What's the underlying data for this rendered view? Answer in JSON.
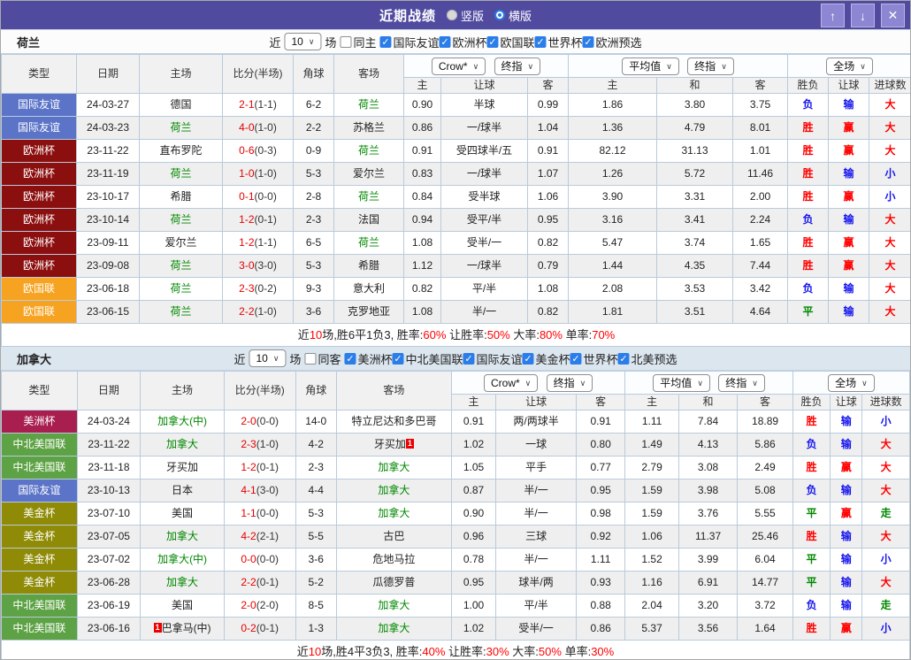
{
  "title_bar": {
    "title": "近期战绩",
    "radio_options": [
      {
        "label": "竖版",
        "selected": false
      },
      {
        "label": "横版",
        "selected": true
      }
    ],
    "buttons": {
      "up": "↑",
      "down": "↓",
      "close": "✕"
    }
  },
  "colors": {
    "titlebar_bg": "#514ba0",
    "focus_team": "#008800",
    "score_red": "#e60000",
    "red_card_badge": "#ee0000",
    "checkbox_blue": "#2b7de9",
    "league": {
      "国际友谊": "#5b74c8",
      "欧洲杯": "#8c0f0f",
      "欧国联": "#f6a321",
      "美洲杯": "#a81e4f",
      "中北美国联": "#5da244",
      "美金杯": "#8f8b06"
    },
    "result": {
      "胜": "#ff0000",
      "负": "#1616ee",
      "平": "#008800",
      "赢": "#ff0000",
      "输": "#1616ee",
      "走": "#008800",
      "大": "#ff0000",
      "小": "#1616ee"
    }
  },
  "table_header": {
    "type": "类型",
    "date": "日期",
    "home": "主场",
    "score": "比分(半场)",
    "corner": "角球",
    "away": "客场",
    "dropdowns": {
      "source": "Crow*",
      "final1": "终指",
      "average": "平均值",
      "final2": "终指",
      "scope": "全场"
    },
    "sub": {
      "home": "主",
      "handicap": "让球",
      "away": "客",
      "avg_home": "主",
      "avg_draw": "和",
      "avg_away": "客",
      "result": "胜负",
      "handicap_result": "让球",
      "goals": "进球数"
    }
  },
  "sections": [
    {
      "team": "荷兰",
      "filter": {
        "near": "近",
        "count": "10",
        "games": "场",
        "same": {
          "label": "同主",
          "checked": false
        },
        "leagues": [
          {
            "label": "国际友谊",
            "checked": true
          },
          {
            "label": "欧洲杯",
            "checked": true
          },
          {
            "label": "欧国联",
            "checked": true
          },
          {
            "label": "世界杯",
            "checked": true
          },
          {
            "label": "欧洲预选",
            "checked": true
          }
        ]
      },
      "rows": [
        {
          "league": "国际友谊",
          "date": "24-03-27",
          "home": "德国",
          "home_focus": false,
          "score": "2-1",
          "half": "(1-1)",
          "corner": "6-2",
          "away": "荷兰",
          "away_focus": true,
          "oh": "0.90",
          "hcap": "半球",
          "oa": "0.99",
          "ah": "1.86",
          "ad": "3.80",
          "aa": "3.75",
          "res": "负",
          "let": "输",
          "goal": "大"
        },
        {
          "league": "国际友谊",
          "date": "24-03-23",
          "home": "荷兰",
          "home_focus": true,
          "score": "4-0",
          "half": "(1-0)",
          "corner": "2-2",
          "away": "苏格兰",
          "away_focus": false,
          "oh": "0.86",
          "hcap": "一/球半",
          "oa": "1.04",
          "ah": "1.36",
          "ad": "4.79",
          "aa": "8.01",
          "res": "胜",
          "let": "赢",
          "goal": "大"
        },
        {
          "league": "欧洲杯",
          "date": "23-11-22",
          "home": "直布罗陀",
          "home_focus": false,
          "score": "0-6",
          "half": "(0-3)",
          "corner": "0-9",
          "away": "荷兰",
          "away_focus": true,
          "oh": "0.91",
          "hcap": "受四球半/五",
          "oa": "0.91",
          "ah": "82.12",
          "ad": "31.13",
          "aa": "1.01",
          "res": "胜",
          "let": "赢",
          "goal": "大"
        },
        {
          "league": "欧洲杯",
          "date": "23-11-19",
          "home": "荷兰",
          "home_focus": true,
          "score": "1-0",
          "half": "(1-0)",
          "corner": "5-3",
          "away": "爱尔兰",
          "away_focus": false,
          "oh": "0.83",
          "hcap": "一/球半",
          "oa": "1.07",
          "ah": "1.26",
          "ad": "5.72",
          "aa": "11.46",
          "res": "胜",
          "let": "输",
          "goal": "小"
        },
        {
          "league": "欧洲杯",
          "date": "23-10-17",
          "home": "希腊",
          "home_focus": false,
          "score": "0-1",
          "half": "(0-0)",
          "corner": "2-8",
          "away": "荷兰",
          "away_focus": true,
          "oh": "0.84",
          "hcap": "受半球",
          "oa": "1.06",
          "ah": "3.90",
          "ad": "3.31",
          "aa": "2.00",
          "res": "胜",
          "let": "赢",
          "goal": "小"
        },
        {
          "league": "欧洲杯",
          "date": "23-10-14",
          "home": "荷兰",
          "home_focus": true,
          "score": "1-2",
          "half": "(0-1)",
          "corner": "2-3",
          "away": "法国",
          "away_focus": false,
          "oh": "0.94",
          "hcap": "受平/半",
          "oa": "0.95",
          "ah": "3.16",
          "ad": "3.41",
          "aa": "2.24",
          "res": "负",
          "let": "输",
          "goal": "大"
        },
        {
          "league": "欧洲杯",
          "date": "23-09-11",
          "home": "爱尔兰",
          "home_focus": false,
          "score": "1-2",
          "half": "(1-1)",
          "corner": "6-5",
          "away": "荷兰",
          "away_focus": true,
          "oh": "1.08",
          "hcap": "受半/一",
          "oa": "0.82",
          "ah": "5.47",
          "ad": "3.74",
          "aa": "1.65",
          "res": "胜",
          "let": "赢",
          "goal": "大"
        },
        {
          "league": "欧洲杯",
          "date": "23-09-08",
          "home": "荷兰",
          "home_focus": true,
          "score": "3-0",
          "half": "(3-0)",
          "corner": "5-3",
          "away": "希腊",
          "away_focus": false,
          "oh": "1.12",
          "hcap": "一/球半",
          "oa": "0.79",
          "ah": "1.44",
          "ad": "4.35",
          "aa": "7.44",
          "res": "胜",
          "let": "赢",
          "goal": "大"
        },
        {
          "league": "欧国联",
          "date": "23-06-18",
          "home": "荷兰",
          "home_focus": true,
          "score": "2-3",
          "half": "(0-2)",
          "corner": "9-3",
          "away": "意大利",
          "away_focus": false,
          "oh": "0.82",
          "hcap": "平/半",
          "oa": "1.08",
          "ah": "2.08",
          "ad": "3.53",
          "aa": "3.42",
          "res": "负",
          "let": "输",
          "goal": "大"
        },
        {
          "league": "欧国联",
          "date": "23-06-15",
          "home": "荷兰",
          "home_focus": true,
          "score": "2-2",
          "half": "(1-0)",
          "corner": "3-6",
          "away": "克罗地亚",
          "away_focus": false,
          "oh": "1.08",
          "hcap": "半/一",
          "oa": "0.82",
          "ah": "1.81",
          "ad": "3.51",
          "aa": "4.64",
          "res": "平",
          "let": "输",
          "goal": "大"
        }
      ],
      "summary": [
        {
          "t": "近",
          "red": false
        },
        {
          "t": "10",
          "red": true
        },
        {
          "t": "场,胜6平1负3, 胜率:",
          "red": false
        },
        {
          "t": "60%",
          "red": true
        },
        {
          "t": " 让胜率:",
          "red": false
        },
        {
          "t": "50%",
          "red": true
        },
        {
          "t": " 大率:",
          "red": false
        },
        {
          "t": "80%",
          "red": true
        },
        {
          "t": " 单率:",
          "red": false
        },
        {
          "t": "70%",
          "red": true
        }
      ]
    },
    {
      "team": "加拿大",
      "filter": {
        "near": "近",
        "count": "10",
        "games": "场",
        "same": {
          "label": "同客",
          "checked": false
        },
        "leagues": [
          {
            "label": "美洲杯",
            "checked": true
          },
          {
            "label": "中北美国联",
            "checked": true
          },
          {
            "label": "国际友谊",
            "checked": true
          },
          {
            "label": "美金杯",
            "checked": true
          },
          {
            "label": "世界杯",
            "checked": true
          },
          {
            "label": "北美预选",
            "checked": true
          }
        ]
      },
      "rows": [
        {
          "league": "美洲杯",
          "date": "24-03-24",
          "home": "加拿大(中)",
          "home_focus": true,
          "score": "2-0",
          "half": "(0-0)",
          "corner": "14-0",
          "away": "特立尼达和多巴哥",
          "away_focus": false,
          "oh": "0.91",
          "hcap": "两/两球半",
          "oa": "0.91",
          "ah": "1.11",
          "ad": "7.84",
          "aa": "18.89",
          "res": "胜",
          "let": "输",
          "goal": "小"
        },
        {
          "league": "中北美国联",
          "date": "23-11-22",
          "home": "加拿大",
          "home_focus": true,
          "score": "2-3",
          "half": "(1-0)",
          "corner": "4-2",
          "away": "牙买加",
          "away_focus": false,
          "away_card": {
            "text": "1",
            "pos": "after"
          },
          "oh": "1.02",
          "hcap": "一球",
          "oa": "0.80",
          "ah": "1.49",
          "ad": "4.13",
          "aa": "5.86",
          "res": "负",
          "let": "输",
          "goal": "大"
        },
        {
          "league": "中北美国联",
          "date": "23-11-18",
          "home": "牙买加",
          "home_focus": false,
          "score": "1-2",
          "half": "(0-1)",
          "corner": "2-3",
          "away": "加拿大",
          "away_focus": true,
          "oh": "1.05",
          "hcap": "平手",
          "oa": "0.77",
          "ah": "2.79",
          "ad": "3.08",
          "aa": "2.49",
          "res": "胜",
          "let": "赢",
          "goal": "大"
        },
        {
          "league": "国际友谊",
          "date": "23-10-13",
          "home": "日本",
          "home_focus": false,
          "score": "4-1",
          "half": "(3-0)",
          "corner": "4-4",
          "away": "加拿大",
          "away_focus": true,
          "oh": "0.87",
          "hcap": "半/一",
          "oa": "0.95",
          "ah": "1.59",
          "ad": "3.98",
          "aa": "5.08",
          "res": "负",
          "let": "输",
          "goal": "大"
        },
        {
          "league": "美金杯",
          "date": "23-07-10",
          "home": "美国",
          "home_focus": false,
          "score": "1-1",
          "half": "(0-0)",
          "corner": "5-3",
          "away": "加拿大",
          "away_focus": true,
          "oh": "0.90",
          "hcap": "半/一",
          "oa": "0.98",
          "ah": "1.59",
          "ad": "3.76",
          "aa": "5.55",
          "res": "平",
          "let": "赢",
          "goal": "走"
        },
        {
          "league": "美金杯",
          "date": "23-07-05",
          "home": "加拿大",
          "home_focus": true,
          "score": "4-2",
          "half": "(2-1)",
          "corner": "5-5",
          "away": "古巴",
          "away_focus": false,
          "oh": "0.96",
          "hcap": "三球",
          "oa": "0.92",
          "ah": "1.06",
          "ad": "11.37",
          "aa": "25.46",
          "res": "胜",
          "let": "输",
          "goal": "大"
        },
        {
          "league": "美金杯",
          "date": "23-07-02",
          "home": "加拿大(中)",
          "home_focus": true,
          "score": "0-0",
          "half": "(0-0)",
          "corner": "3-6",
          "away": "危地马拉",
          "away_focus": false,
          "oh": "0.78",
          "hcap": "半/一",
          "oa": "1.11",
          "ah": "1.52",
          "ad": "3.99",
          "aa": "6.04",
          "res": "平",
          "let": "输",
          "goal": "小"
        },
        {
          "league": "美金杯",
          "date": "23-06-28",
          "home": "加拿大",
          "home_focus": true,
          "score": "2-2",
          "half": "(0-1)",
          "corner": "5-2",
          "away": "瓜德罗普",
          "away_focus": false,
          "oh": "0.95",
          "hcap": "球半/两",
          "oa": "0.93",
          "ah": "1.16",
          "ad": "6.91",
          "aa": "14.77",
          "res": "平",
          "let": "输",
          "goal": "大"
        },
        {
          "league": "中北美国联",
          "date": "23-06-19",
          "home": "美国",
          "home_focus": false,
          "score": "2-0",
          "half": "(2-0)",
          "corner": "8-5",
          "away": "加拿大",
          "away_focus": true,
          "oh": "1.00",
          "hcap": "平/半",
          "oa": "0.88",
          "ah": "2.04",
          "ad": "3.20",
          "aa": "3.72",
          "res": "负",
          "let": "输",
          "goal": "走"
        },
        {
          "league": "中北美国联",
          "date": "23-06-16",
          "home": "巴拿马(中)",
          "home_focus": false,
          "home_card": {
            "text": "1",
            "pos": "before"
          },
          "score": "0-2",
          "half": "(0-1)",
          "corner": "1-3",
          "away": "加拿大",
          "away_focus": true,
          "oh": "1.02",
          "hcap": "受半/一",
          "oa": "0.86",
          "ah": "5.37",
          "ad": "3.56",
          "aa": "1.64",
          "res": "胜",
          "let": "赢",
          "goal": "小"
        }
      ],
      "summary": [
        {
          "t": "近",
          "red": false
        },
        {
          "t": "10",
          "red": true
        },
        {
          "t": "场,胜4平3负3, 胜率:",
          "red": false
        },
        {
          "t": "40%",
          "red": true
        },
        {
          "t": " 让胜率:",
          "red": false
        },
        {
          "t": "30%",
          "red": true
        },
        {
          "t": " 大率:",
          "red": false
        },
        {
          "t": "50%",
          "red": true
        },
        {
          "t": " 单率:",
          "red": false
        },
        {
          "t": "30%",
          "red": true
        }
      ]
    }
  ]
}
